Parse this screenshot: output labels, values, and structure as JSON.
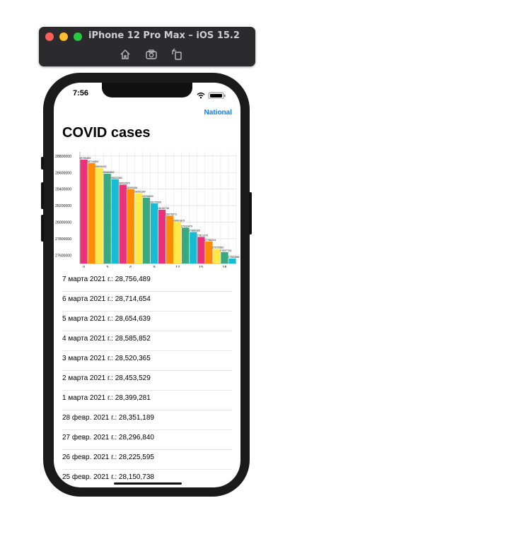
{
  "simulator": {
    "title": "iPhone 12 Pro Max – iOS 15.2"
  },
  "status_bar": {
    "time": "7:56"
  },
  "nav": {
    "right_button": "National"
  },
  "page": {
    "title": "COVID cases"
  },
  "chart_data": {
    "type": "bar",
    "x": [
      0,
      1,
      2,
      3,
      4,
      5,
      6,
      7,
      8,
      9,
      10,
      11,
      12,
      13,
      14,
      15,
      16,
      17,
      18,
      19
    ],
    "values": [
      28756489,
      28714654,
      28654639,
      28585852,
      28520365,
      28453529,
      28399281,
      28351189,
      28296840,
      28225595,
      28150738,
      28078373,
      28001815,
      27933476,
      27880385,
      27821370,
      27768224,
      27675582,
      27637726,
      27560888
    ],
    "value_labels": [
      "28756489",
      "28714654",
      "28654639",
      "28585852",
      "28520365",
      "28453529",
      "28399281",
      "28351189",
      "28296840",
      "28225595",
      "28150738",
      "28078373",
      "28001815",
      "27933476",
      "27880385",
      "27821370",
      "27768224",
      "27675582",
      "27637726",
      "27560888"
    ],
    "x_ticks": [
      "0",
      "3",
      "6",
      "9",
      "12",
      "15",
      "18"
    ],
    "y_ticks": [
      "28800000",
      "28600000",
      "28400000",
      "28200000",
      "28000000",
      "27800000",
      "27600000"
    ],
    "ylim": [
      27500000,
      28850000
    ],
    "grid": true,
    "colors": [
      "#e8327a",
      "#ff8c00",
      "#ffe94a",
      "#3aa981",
      "#17bcd3"
    ]
  },
  "cases": [
    "7 марта 2021 г.: 28,756,489",
    "6 марта 2021 г.: 28,714,654",
    "5 марта 2021 г.: 28,654,639",
    "4 марта 2021 г.: 28,585,852",
    "3 марта 2021 г.: 28,520,365",
    "2 марта 2021 г.: 28,453,529",
    "1 марта 2021 г.: 28,399,281",
    "28 февр. 2021 г.: 28,351,189",
    "27 февр. 2021 г.: 28,296,840",
    "26 февр. 2021 г.: 28,225,595",
    "25 февр. 2021 г.: 28,150,738"
  ]
}
